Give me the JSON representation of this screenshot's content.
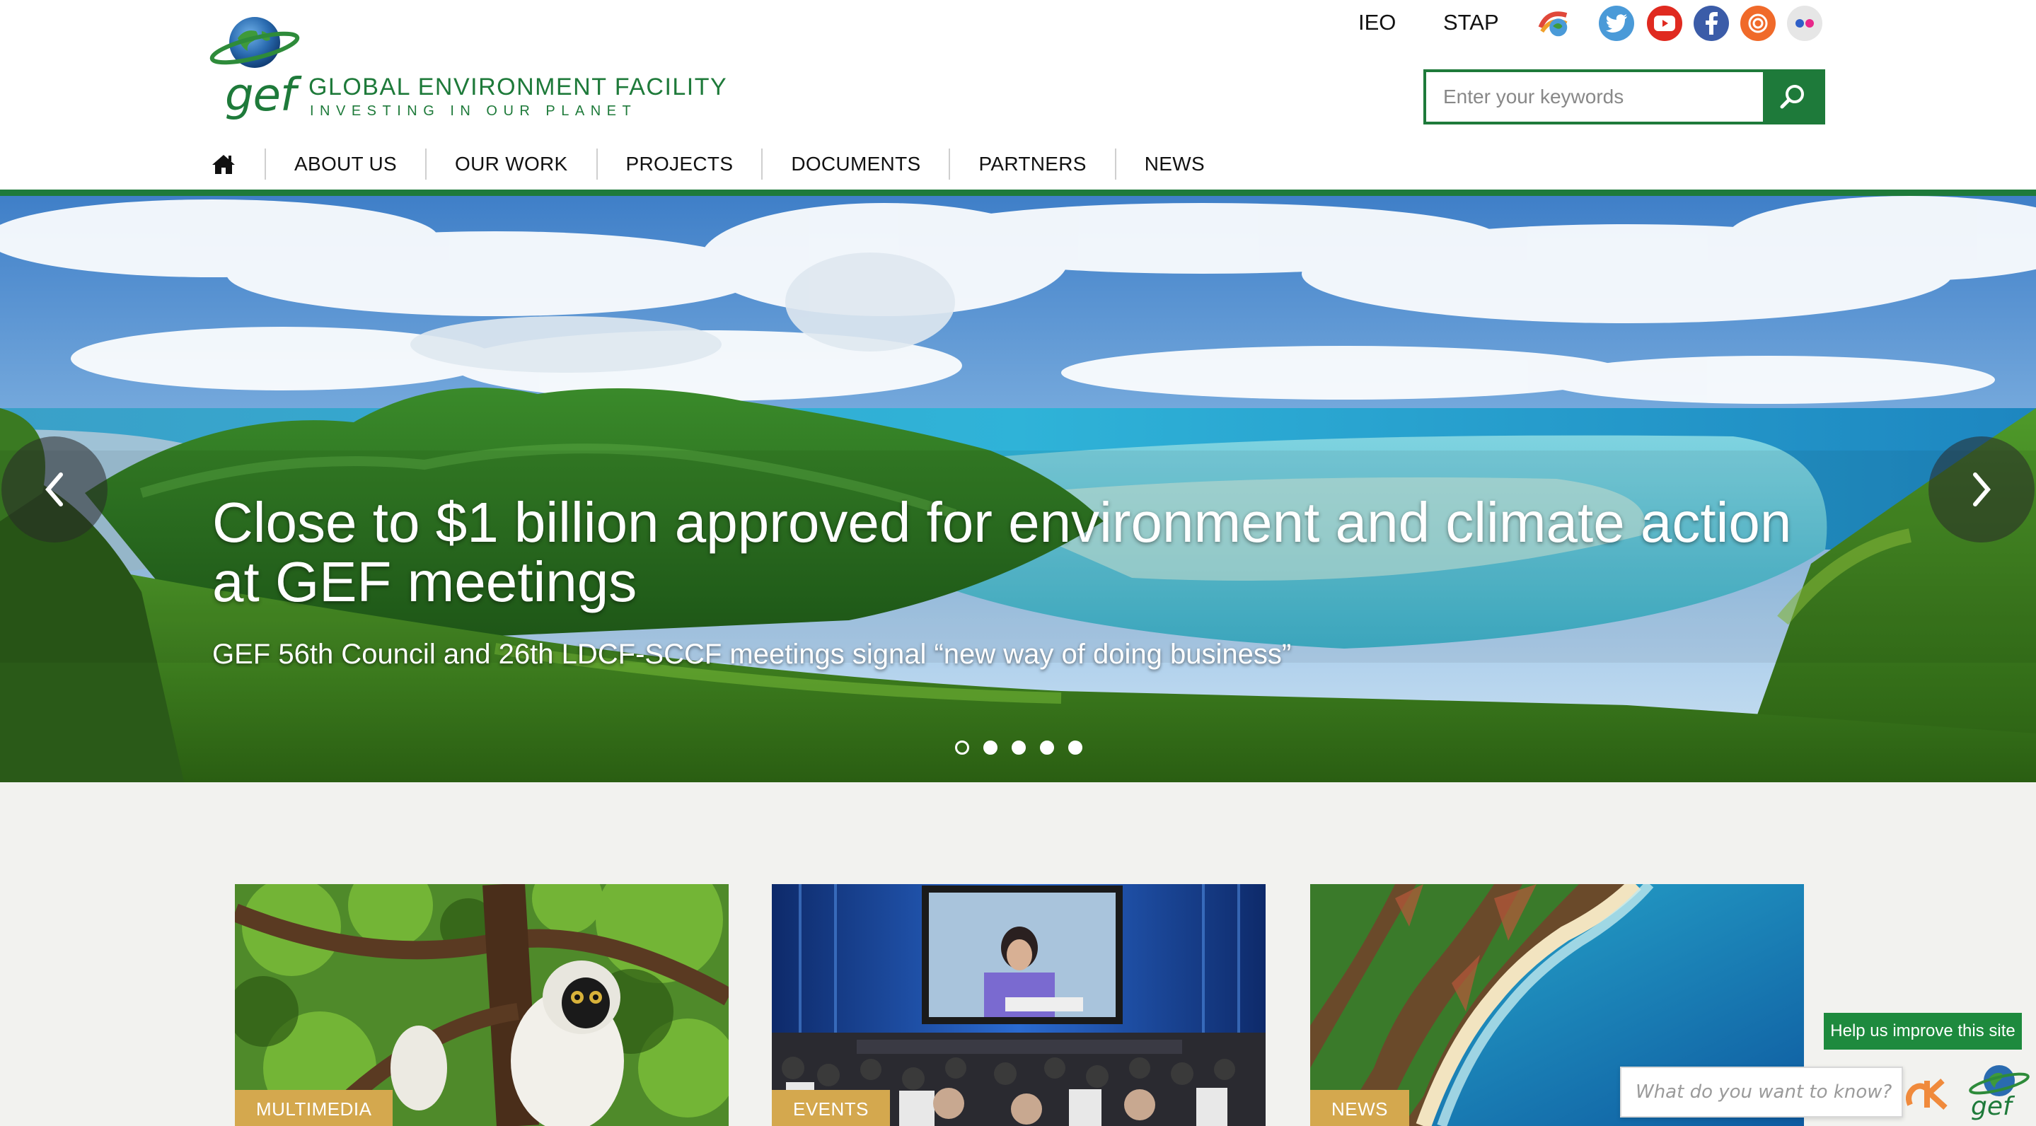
{
  "header": {
    "logo": {
      "mark": "gef",
      "org_name": "GLOBAL ENVIRONMENT FACILITY",
      "tagline": "INVESTING IN OUR PLANET"
    },
    "top_links": [
      "IEO",
      "STAP"
    ],
    "social": [
      {
        "name": "gef-network-icon"
      },
      {
        "name": "twitter-icon",
        "color": "#4a9ad8"
      },
      {
        "name": "youtube-icon",
        "color": "#e02a20"
      },
      {
        "name": "facebook-icon",
        "color": "#3b5ca8"
      },
      {
        "name": "instagram-icon",
        "color": "#f06a2a"
      },
      {
        "name": "flickr-icon",
        "color": "#e6e6e6"
      }
    ],
    "search": {
      "placeholder": "Enter your keywords",
      "value": ""
    },
    "nav": [
      "ABOUT US",
      "OUR WORK",
      "PROJECTS",
      "DOCUMENTS",
      "PARTNERS",
      "NEWS"
    ]
  },
  "hero": {
    "title": "Close to $1 billion approved for environment and climate action at GEF meetings",
    "subtitle": "GEF 56th Council and 26th LDCF-SCCF meetings signal “new way of doing business”",
    "slides_count": 5,
    "active_slide": 0
  },
  "cards": [
    {
      "label": "MULTIMEDIA"
    },
    {
      "label": "EVENTS"
    },
    {
      "label": "NEWS"
    }
  ],
  "feedback": {
    "tab_label": "Help us improve this site",
    "ask_placeholder": "What do you want to know?",
    "ask_brand": "gef"
  },
  "colors": {
    "brand_green": "#1e7a3a",
    "label_gold": "#d4a84e"
  }
}
